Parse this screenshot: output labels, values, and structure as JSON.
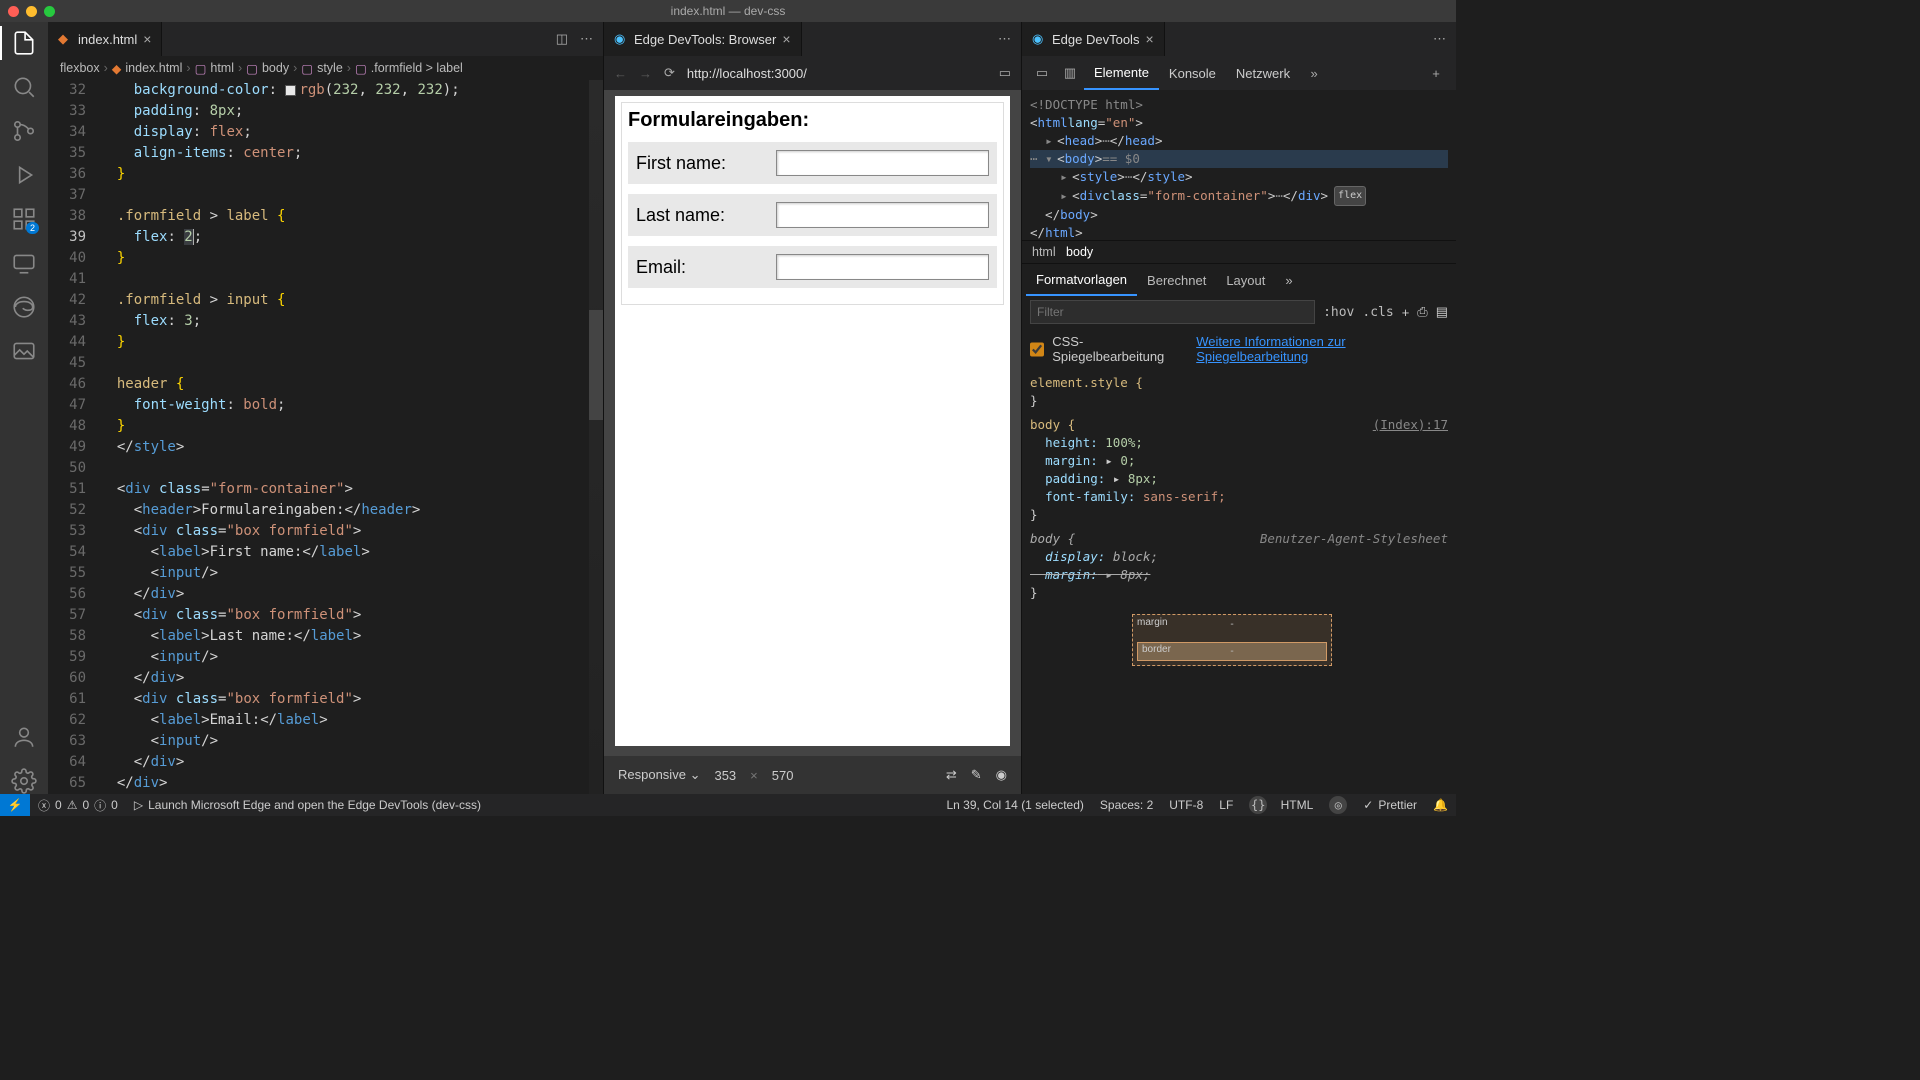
{
  "window": {
    "title": "index.html — dev-css"
  },
  "editorTab": {
    "name": "index.html"
  },
  "browserTab": {
    "name": "Edge DevTools: Browser"
  },
  "devtoolsTab": {
    "name": "Edge DevTools"
  },
  "breadcrumbs": {
    "p0": "flexbox",
    "p1": "index.html",
    "p2": "html",
    "p3": "body",
    "p4": "style",
    "p5": ".formfield > label"
  },
  "lines": {
    "32": "32",
    "33": "33",
    "34": "34",
    "35": "35",
    "36": "36",
    "37": "37",
    "38": "38",
    "39": "39",
    "40": "40",
    "41": "41",
    "42": "42",
    "43": "43",
    "44": "44",
    "45": "45",
    "46": "46",
    "47": "47",
    "48": "48",
    "49": "49",
    "50": "50",
    "51": "51",
    "52": "52",
    "53": "53",
    "54": "54",
    "55": "55",
    "56": "56",
    "57": "57",
    "58": "58",
    "59": "59",
    "60": "60",
    "61": "61",
    "62": "62",
    "63": "63",
    "64": "64",
    "65": "65"
  },
  "url": "http://localhost:3000/",
  "form": {
    "heading": "Formulareingaben:",
    "first": "First name:",
    "last": "Last name:",
    "email": "Email:"
  },
  "dims": {
    "mode": "Responsive",
    "w": "353",
    "sep": "×",
    "h": "570"
  },
  "dtTabs": {
    "elements": "Elemente",
    "console": "Konsole",
    "network": "Netzwerk"
  },
  "crumb2": {
    "a": "html",
    "b": "body"
  },
  "styleTabs": {
    "a": "Formatvorlagen",
    "b": "Berechnet",
    "c": "Layout"
  },
  "filter": {
    "placeholder": "Filter",
    "hov": ":hov",
    "cls": ".cls"
  },
  "mirror": {
    "label": "CSS-Spiegelbearbeitung",
    "link": "Weitere Informationen zur Spiegelbearbeitung"
  },
  "rules": {
    "elstyle": "element.style {",
    "bodysel": "body {",
    "src": "(Index):17",
    "height": "height:",
    "heightv": "100%;",
    "margin": "margin:",
    "marginv": "0;",
    "padding": "padding:",
    "paddingv": "8px;",
    "ff": "font-family:",
    "ffv": "sans-serif;",
    "ua": "Benutzer-Agent-Stylesheet",
    "display": "display:",
    "displayv": "block;",
    "margin2": "margin:",
    "margin2v": "8px;"
  },
  "boxmodel": {
    "margin": "margin",
    "border": "border",
    "dash": "-"
  },
  "status": {
    "errors0": "0",
    "warn0": "0",
    "info0": "0",
    "launch": "Launch Microsoft Edge and open the Edge DevTools (dev-css)",
    "pos": "Ln 39, Col 14 (1 selected)",
    "spaces": "Spaces: 2",
    "enc": "UTF-8",
    "eol": "LF",
    "lang": "HTML",
    "prettier": "Prettier"
  },
  "dom": {
    "doctype": "<!DOCTYPE html>",
    "flexbadge": "flex",
    "eq0": " == $0"
  },
  "extbadge": "2"
}
